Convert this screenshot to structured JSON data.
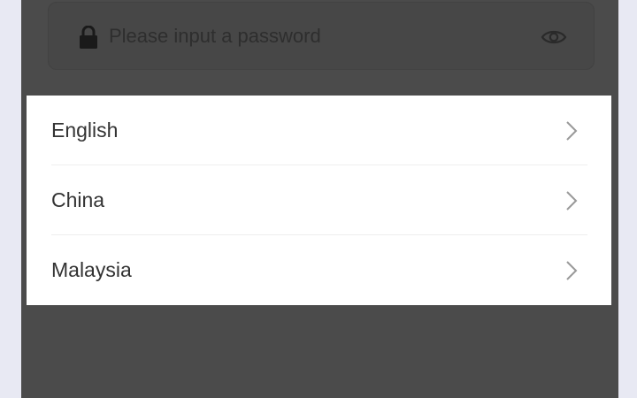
{
  "password": {
    "placeholder": "Please input a password",
    "lock_icon": "lock-icon",
    "visibility_icon": "eye-icon"
  },
  "language_sheet": {
    "items": [
      {
        "label": "English",
        "icon": "chevron-right-icon"
      },
      {
        "label": "China",
        "icon": "chevron-right-icon"
      },
      {
        "label": "Malaysia",
        "icon": "chevron-right-icon"
      }
    ]
  },
  "colors": {
    "backdrop": "#4b4b4b",
    "page_background": "#e8e9f3",
    "sheet": "#ffffff",
    "text": "#333333",
    "chevron": "#999999"
  }
}
